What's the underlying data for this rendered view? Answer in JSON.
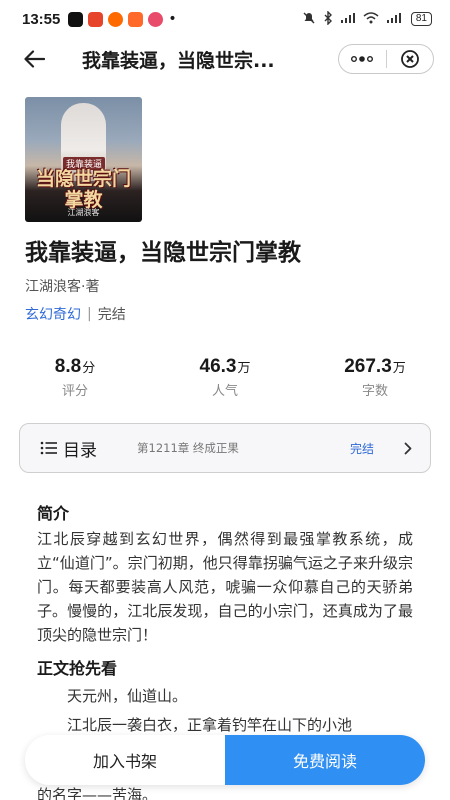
{
  "status_bar": {
    "time": "13:55",
    "app_icons": [
      {
        "name": "tiktok-icon",
        "color": "#111111"
      },
      {
        "name": "game-controller-icon",
        "color": "#e6452b"
      },
      {
        "name": "taobao-icon",
        "color": "#ff6a00"
      },
      {
        "name": "grid-app-icon",
        "color": "#ff6a2b"
      },
      {
        "name": "candy-icon",
        "color": "#e94b6a"
      }
    ],
    "battery": "81"
  },
  "top_bar": {
    "title": "我靠装逼，当隐世宗..."
  },
  "book": {
    "cover": {
      "tag": "我靠装逼",
      "title_art": "当隐世宗门掌教",
      "author": "江湖浪客"
    },
    "title": "我靠装逼，当隐世宗门掌教",
    "author_line": "江湖浪客·著",
    "genre": "玄幻奇幻",
    "separator": "|",
    "status": "完结"
  },
  "stats": [
    {
      "value": "8.8",
      "unit": "分",
      "label": "评分"
    },
    {
      "value": "46.3",
      "unit": "万",
      "label": "人气"
    },
    {
      "value": "267.3",
      "unit": "万",
      "label": "字数"
    }
  ],
  "toc": {
    "label": "目录",
    "latest_chapter": "第1211章 终成正果",
    "status": "完结"
  },
  "intro": {
    "title": "简介",
    "text": "江北辰穿越到玄幻世界，偶然得到最强掌教系统，成立“仙道门”。宗门初期，他只得靠拐骗气运之子来升级宗门。每天都要装高人风范，唬骗一众仰慕自己的天骄弟子。慢慢的，江北辰发现，自己的小宗门，还真成为了最顶尖的隐世宗门！"
  },
  "preview": {
    "title": "正文抢先看",
    "paragraphs": [
      "天元州，仙道山。",
      "江北辰一袭白衣，正拿着钓竿在山下的小池",
      "的名字——苦海。"
    ]
  },
  "actions": {
    "add_shelf": "加入书架",
    "read_free": "免费阅读"
  }
}
